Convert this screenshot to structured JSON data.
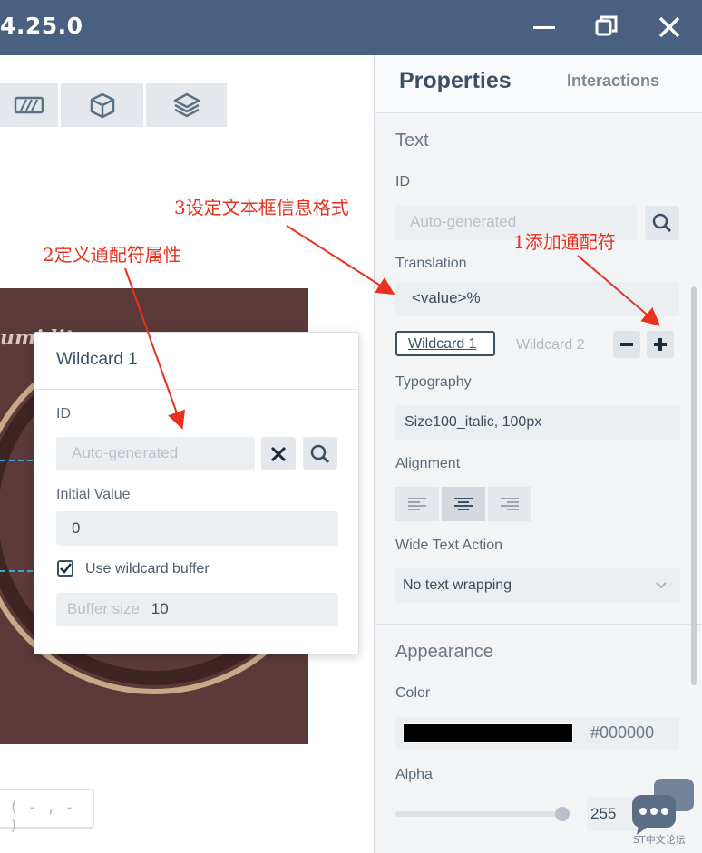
{
  "window": {
    "title": "4.25.0"
  },
  "canvas": {
    "coord_readout": "( - , - )"
  },
  "popup": {
    "title": "Wildcard 1",
    "id_label": "ID",
    "id_placeholder": "Auto-generated",
    "initial_value_label": "Initial Value",
    "initial_value": "0",
    "use_buffer_label": "Use wildcard buffer",
    "use_buffer_checked": true,
    "buffer_size_label": "Buffer size",
    "buffer_size_value": "10"
  },
  "panel": {
    "tabs": [
      {
        "label": "Properties",
        "active": true
      },
      {
        "label": "Interactions",
        "active": false
      }
    ],
    "text_section": {
      "title": "Text",
      "id_label": "ID",
      "id_placeholder": "Auto-generated",
      "translation_label": "Translation",
      "translation_value": "<value>%",
      "wildcards": [
        {
          "label": "Wildcard 1",
          "selected": true
        },
        {
          "label": "Wildcard 2",
          "selected": false
        }
      ],
      "typography_label": "Typography",
      "typography_value": "Size100_italic, 100px",
      "alignment_label": "Alignment",
      "alignment_selected": "center",
      "wide_text_label": "Wide Text Action",
      "wide_text_value": "No text wrapping"
    },
    "appearance_section": {
      "title": "Appearance",
      "color_label": "Color",
      "color_value": "#000000",
      "alpha_label": "Alpha",
      "alpha_value": "255",
      "alpha_fraction": 1.0
    }
  },
  "annotations": {
    "a1": "1添加通配符",
    "a2": "2定义通配符属性",
    "a3": "3设定文本框信息格式",
    "color": "#e8311f"
  },
  "watermark": "ST中文论坛",
  "colors": {
    "titlebar": "#4a6080",
    "canvas_bg": "#5b3a39",
    "accent": "#3b4f66"
  }
}
